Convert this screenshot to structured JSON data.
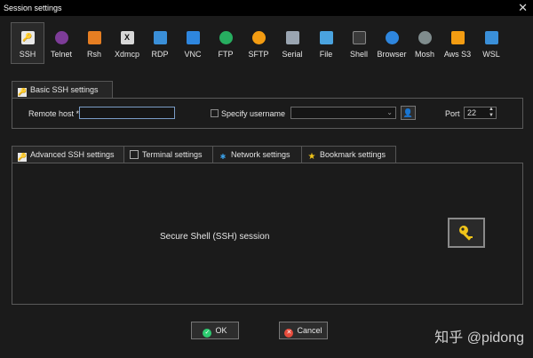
{
  "window": {
    "title": "Session settings"
  },
  "toolbar": {
    "items": [
      {
        "label": "SSH",
        "icon": "ssh-key-icon",
        "color": "#f0c419"
      },
      {
        "label": "Telnet",
        "icon": "telnet-icon",
        "color": "#8e44ad"
      },
      {
        "label": "Rsh",
        "icon": "rsh-icon",
        "color": "#e67e22"
      },
      {
        "label": "Xdmcp",
        "icon": "xdmcp-icon",
        "color": "#cfcfcf"
      },
      {
        "label": "RDP",
        "icon": "rdp-monitor-icon",
        "color": "#3a8fd8"
      },
      {
        "label": "VNC",
        "icon": "vnc-icon",
        "color": "#2e86de"
      },
      {
        "label": "FTP",
        "icon": "ftp-globe-icon",
        "color": "#27ae60"
      },
      {
        "label": "SFTP",
        "icon": "sftp-icon",
        "color": "#f39c12"
      },
      {
        "label": "Serial",
        "icon": "serial-satellite-icon",
        "color": "#9aa5b1"
      },
      {
        "label": "File",
        "icon": "file-icon",
        "color": "#4aa3df"
      },
      {
        "label": "Shell",
        "icon": "shell-terminal-icon",
        "color": "#555555"
      },
      {
        "label": "Browser",
        "icon": "browser-globe-icon",
        "color": "#2e86de"
      },
      {
        "label": "Mosh",
        "icon": "mosh-antenna-icon",
        "color": "#7f8c8d"
      },
      {
        "label": "Aws S3",
        "icon": "aws-s3-icon",
        "color": "#f39c12"
      },
      {
        "label": "WSL",
        "icon": "wsl-windows-icon",
        "color": "#3a8fd8"
      }
    ]
  },
  "basic": {
    "tab_label": "Basic SSH settings",
    "remote_host_label": "Remote host *",
    "remote_host_value": "",
    "specify_username_label": "Specify username",
    "username_value": "",
    "port_label": "Port",
    "port_value": "22"
  },
  "advanced_tabs": [
    {
      "label": "Advanced SSH settings",
      "icon": "tools-icon"
    },
    {
      "label": "Terminal settings",
      "icon": "terminal-icon"
    },
    {
      "label": "Network settings",
      "icon": "network-icon"
    },
    {
      "label": "Bookmark settings",
      "icon": "star-icon"
    }
  ],
  "session_description": "Secure Shell (SSH) session",
  "buttons": {
    "ok": "OK",
    "cancel": "Cancel"
  },
  "watermark": "知乎 @pidong",
  "colors": {
    "ok": "#2ecc71",
    "cancel": "#e74c3c",
    "focus_border": "#7a9cc6",
    "key_icon": "#f0c419"
  }
}
